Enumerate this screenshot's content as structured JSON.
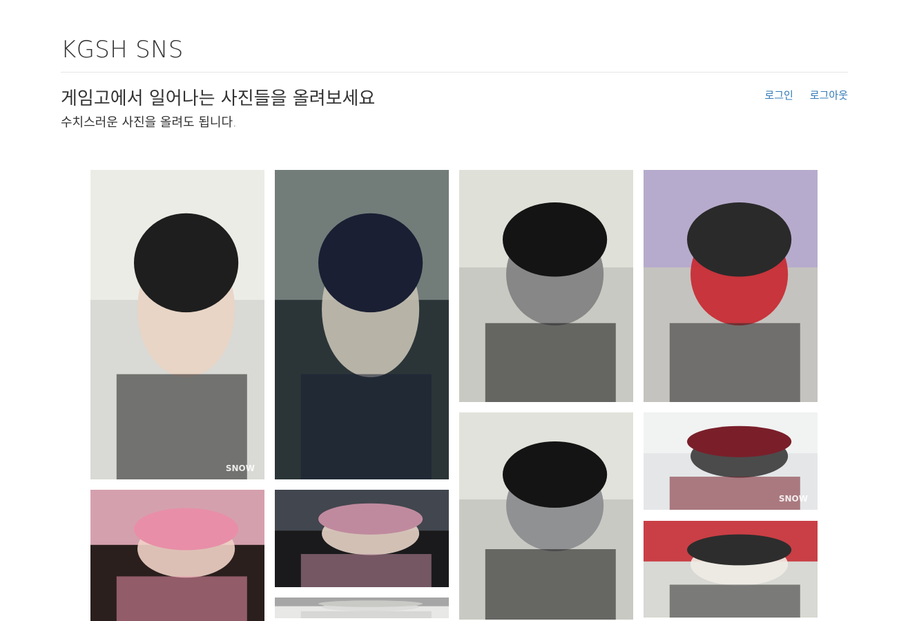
{
  "site": {
    "title": "KGSH SNS"
  },
  "header": {
    "headline": "게임고에서 일어나는 사진들을 올려보세요",
    "subline": "수치스러운 사진을 올려도 됩니다."
  },
  "nav": {
    "login": "로그인",
    "logout": "로그아웃"
  },
  "gallery": {
    "watermark": "SNOW",
    "photos": [
      {
        "name": "photo-smiling-student-classroom",
        "palette": [
          "#d9d9d5",
          "#eeeeea",
          "#1e1e1e",
          "#e9d4c4"
        ],
        "watermark": true
      },
      {
        "name": "photo-student-glass-door-night",
        "palette": [
          "#2b3538",
          "#7f8a86",
          "#1a1f33",
          "#c6c1b4"
        ],
        "watermark": false
      },
      {
        "name": "photo-glasses-closeup-side",
        "palette": [
          "#c8c9c2",
          "#e3e4dc",
          "#141414",
          "#7e7f80"
        ],
        "watermark": false
      },
      {
        "name": "photo-student-convenience-store",
        "palette": [
          "#c5c3bf",
          "#b4a7cf",
          "#2a2a2a",
          "#c8262d"
        ],
        "watermark": false
      },
      {
        "name": "photo-pink-wigs-group",
        "palette": [
          "#2a1f1d",
          "#f3b7c8",
          "#e88ea8",
          "#f1d2c6"
        ],
        "watermark": false
      },
      {
        "name": "photo-night-dance-performance",
        "palette": [
          "#1a1a1c",
          "#4a4f57",
          "#c08a9e",
          "#e7d3c6"
        ],
        "watermark": false
      },
      {
        "name": "photo-glasses-closeup-earphone",
        "palette": [
          "#c9c9c4",
          "#e6e6e0",
          "#141414",
          "#8a8b8e"
        ],
        "watermark": false
      },
      {
        "name": "photo-cafeteria-students",
        "palette": [
          "#e4e6e8",
          "#f3f3f3",
          "#7a1f2a",
          "#3a3a3a"
        ],
        "watermark": true
      },
      {
        "name": "photo-store-fridges",
        "palette": [
          "#d8d8d4",
          "#c7242c",
          "#2d2d2d",
          "#efece4"
        ],
        "watermark": false
      },
      {
        "name": "photo-partial-bottom",
        "palette": [
          "#e8e8e6",
          "#9a9a9a",
          "#c9c9c6",
          "#dcdcda"
        ],
        "watermark": false
      }
    ]
  }
}
